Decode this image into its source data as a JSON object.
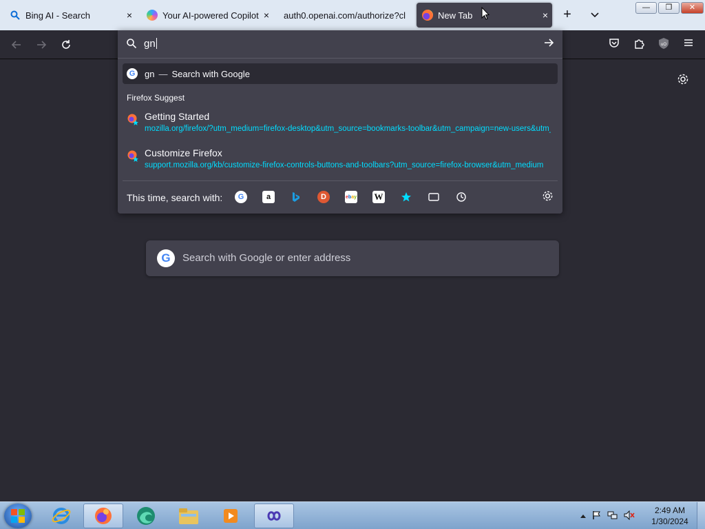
{
  "tabs": [
    {
      "title": "Bing AI - Search",
      "icon": "search-icon",
      "active": false
    },
    {
      "title": "Your AI-powered Copilot fo",
      "icon": "copilot-icon",
      "active": false
    },
    {
      "title": "auth0.openai.com/authorize?cl",
      "icon": "",
      "active": false
    },
    {
      "title": "New Tab",
      "icon": "firefox-icon",
      "active": true
    }
  ],
  "tab_close_glyph": "×",
  "tab_new_glyph": "+",
  "tab_list_glyph": "⌄",
  "window_buttons": {
    "minimize": "—",
    "maximize": "❐",
    "close": "✕"
  },
  "urlbar": {
    "query": "gn",
    "search_row": {
      "query": "gn",
      "dash": "—",
      "action": "Search with Google"
    },
    "group_label": "Firefox Suggest",
    "suggestions": [
      {
        "title": "Getting Started",
        "url": "mozilla.org/firefox/?utm_medium=firefox-desktop&utm_source=bookmarks-toolbar&utm_campaign=new-users&utm_content=-global"
      },
      {
        "title": "Customize Firefox",
        "url": "support.mozilla.org/kb/customize-firefox-controls-buttons-and-toolbars?utm_source=firefox-browser&utm_medium"
      }
    ],
    "footer_label": "This time, search with:",
    "engines": [
      "google-icon",
      "amazon-icon",
      "bing-icon",
      "duckduckgo-icon",
      "ebay-icon",
      "wikipedia-icon",
      "bookmarks-icon",
      "tabs-icon",
      "history-icon"
    ]
  },
  "newtab": {
    "search_placeholder": "Search with Google or enter address"
  },
  "taskbar": {
    "clock_time": "2:49 AM",
    "clock_date": "1/30/2024",
    "apps": [
      "internet-explorer-icon",
      "firefox-icon",
      "edge-beta-icon",
      "file-explorer-icon",
      "media-player-icon",
      "infinity-app-icon"
    ]
  },
  "colors": {
    "accent": "#00ddff",
    "toolbar": "#2b2a33",
    "panel": "#42414d"
  }
}
